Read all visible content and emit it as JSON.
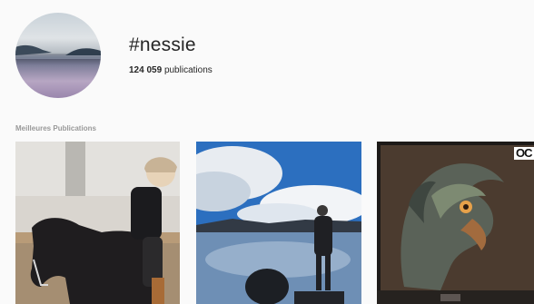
{
  "profile": {
    "hashtag": "#nessie",
    "post_count": "124 059",
    "post_count_label": "publications"
  },
  "sections": {
    "top_posts_label": "Meilleures Publications"
  },
  "posts": [
    {
      "subject": "rider-on-horse"
    },
    {
      "subject": "lake-with-woman"
    },
    {
      "subject": "dragon-on-screen",
      "corner_text": "OC"
    }
  ]
}
